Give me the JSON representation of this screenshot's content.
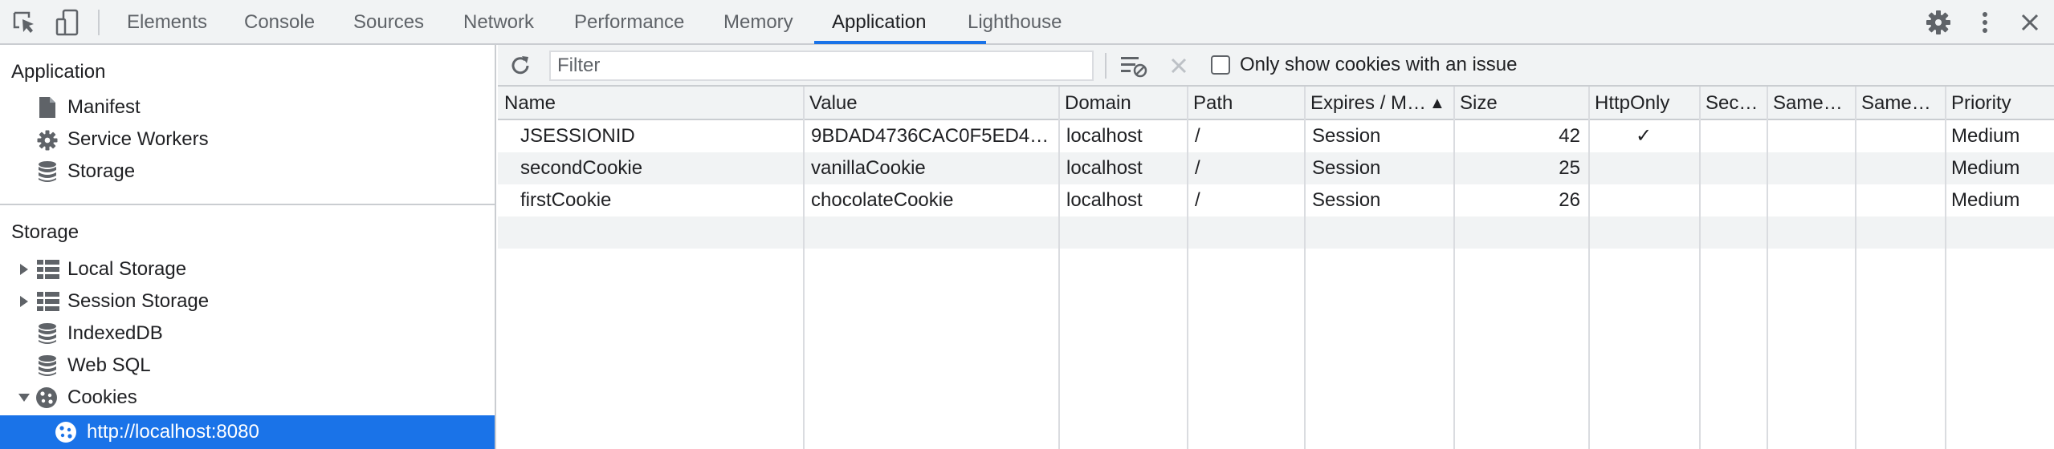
{
  "tabs": [
    {
      "label": "Elements",
      "active": false
    },
    {
      "label": "Console",
      "active": false
    },
    {
      "label": "Sources",
      "active": false
    },
    {
      "label": "Network",
      "active": false
    },
    {
      "label": "Performance",
      "active": false
    },
    {
      "label": "Memory",
      "active": false
    },
    {
      "label": "Application",
      "active": true
    },
    {
      "label": "Lighthouse",
      "active": false
    }
  ],
  "toolbar_icons": {
    "inspect": "inspect-element-icon",
    "device": "device-toolbar-icon",
    "settings": "gear-icon",
    "more": "more-vertical-icon",
    "close": "close-icon"
  },
  "sidebar": {
    "application_header": "Application",
    "application_items": [
      {
        "label": "Manifest",
        "icon": "document-icon"
      },
      {
        "label": "Service Workers",
        "icon": "gear-icon"
      },
      {
        "label": "Storage",
        "icon": "database-icon"
      }
    ],
    "storage_header": "Storage",
    "storage_items": [
      {
        "label": "Local Storage",
        "icon": "table-icon",
        "expander": "collapsed"
      },
      {
        "label": "Session Storage",
        "icon": "table-icon",
        "expander": "collapsed"
      },
      {
        "label": "IndexedDB",
        "icon": "database-icon",
        "expander": "none"
      },
      {
        "label": "Web SQL",
        "icon": "database-icon",
        "expander": "none"
      },
      {
        "label": "Cookies",
        "icon": "cookie-icon",
        "expander": "expanded"
      }
    ],
    "cookie_origin": {
      "label": "http://localhost:8080",
      "icon": "cookie-icon",
      "selected": true
    }
  },
  "cookie_toolbar": {
    "refresh_icon": "refresh-icon",
    "filter_placeholder": "Filter",
    "filter_value": "",
    "clear_filtered_icon": "clear-filtered-icon",
    "delete_icon": "delete-x-icon",
    "issue_checkbox_label": "Only show cookies with an issue",
    "issue_checkbox_checked": false
  },
  "cookie_table": {
    "columns": [
      "Name",
      "Value",
      "Domain",
      "Path",
      "Expires / M…",
      "Size",
      "HttpOnly",
      "Sec…",
      "Same…",
      "Same…",
      "Priority"
    ],
    "sort_indicator": "▲",
    "rows": [
      {
        "name": "JSESSIONID",
        "value": "9BDAD4736CAC0F5ED4…",
        "domain": "localhost",
        "path": "/",
        "expires": "Session",
        "size": "42",
        "httponly": "✓",
        "secure": "",
        "samesite": "",
        "sameparty": "",
        "priority": "Medium"
      },
      {
        "name": "secondCookie",
        "value": "vanillaCookie",
        "domain": "localhost",
        "path": "/",
        "expires": "Session",
        "size": "25",
        "httponly": "",
        "secure": "",
        "samesite": "",
        "sameparty": "",
        "priority": "Medium"
      },
      {
        "name": "firstCookie",
        "value": "chocolateCookie",
        "domain": "localhost",
        "path": "/",
        "expires": "Session",
        "size": "26",
        "httponly": "",
        "secure": "",
        "samesite": "",
        "sameparty": "",
        "priority": "Medium"
      }
    ]
  },
  "colors": {
    "accent": "#1a73e8",
    "toolbar_bg": "#f1f3f4",
    "border": "#cacdd1",
    "icon_gray": "#5f6368"
  }
}
